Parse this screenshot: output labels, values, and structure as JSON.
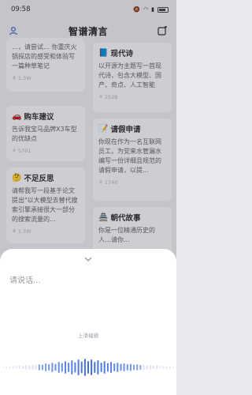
{
  "status_bar": {
    "time": "09:58"
  },
  "header": {
    "title": "智谱清言"
  },
  "cards_left": [
    {
      "title": "",
      "emoji": "",
      "text": "…，请尝试…\n你重庆火锅探店的感受和体验写一篇种草笔记",
      "count": "1.3W"
    },
    {
      "title": "购车建议",
      "emoji": "🚗",
      "text": "告诉我宝马品牌X3车型的优缺点",
      "count": "5781"
    },
    {
      "title": "不足反思",
      "emoji": "🤔",
      "text": "请帮我写一段基于论文提出\"以大模型去替代搜索引擎承接很大一部分的搜索流量的…",
      "count": "1.3W"
    }
  ],
  "cards_right": [
    {
      "title": "现代诗",
      "emoji": "📘",
      "text": "以开源为主题写一首现代诗，包含大模型、国产、奇点、人工智能",
      "count": "2528"
    },
    {
      "title": "请假申请",
      "emoji": "📝",
      "text": "你现在作为一名互联网员工，为党来水管漏水编写一份详细且规范的请假申请，以提…",
      "count": "1740"
    },
    {
      "title": "朝代故事",
      "emoji": "🏯",
      "text": "你是一位精通历史的人…请你…",
      "count": ""
    }
  ],
  "voice": {
    "placeholder": "请说话...",
    "hint": "上滑编辑"
  },
  "colors": {
    "wave_blue": "#3f6fd8",
    "wave_light": "#c3cde6",
    "sheet_bg": "#ffffff",
    "page_bg": "#e9eaee"
  },
  "icons": {
    "header_left": "user-icon",
    "header_right": "new-chat-icon",
    "collapse": "chevron-down-icon",
    "count": "fire-icon"
  }
}
